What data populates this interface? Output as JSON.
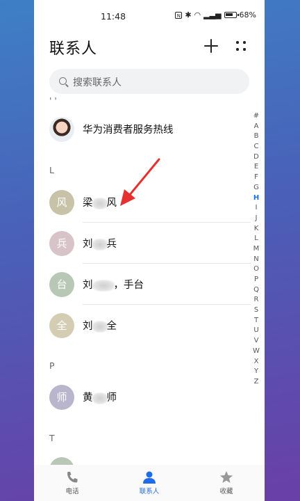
{
  "status_bar": {
    "time": "11:48",
    "battery": "68%"
  },
  "header": {
    "title": "联系人"
  },
  "search": {
    "placeholder": "搜索联系人"
  },
  "sections": {
    "top_marker": "' '",
    "L": "L",
    "P": "P",
    "T": "T"
  },
  "contacts": [
    {
      "name": "华为消费者服务热线",
      "avatar": ""
    },
    {
      "avatar": "风",
      "name_start": "梁",
      "name_end": "风"
    },
    {
      "avatar": "兵",
      "name_start": "刘",
      "name_end": "兵"
    },
    {
      "avatar": "台",
      "name_start": "刘",
      "name_end": "，手台"
    },
    {
      "avatar": "全",
      "name_start": "刘",
      "name_end": "全"
    },
    {
      "avatar": "师",
      "name_start": "黄",
      "name_end": "师"
    }
  ],
  "index_letters": [
    "#",
    "A",
    "B",
    "C",
    "D",
    "E",
    "F",
    "G",
    "H",
    "I",
    "J",
    "K",
    "L",
    "M",
    "N",
    "O",
    "P",
    "Q",
    "R",
    "S",
    "T",
    "U",
    "V",
    "W",
    "X",
    "Y",
    "Z"
  ],
  "active_index": "H",
  "bottom_nav": {
    "calls": "电话",
    "contacts": "联系人",
    "favorites": "收藏"
  },
  "colors": {
    "accent": "#1e6ce8",
    "avatar_feng": "#c8c2a8",
    "avatar_bing": "#d8c4c8",
    "avatar_tai": "#b7c8b5",
    "avatar_quan": "#d4cdb4",
    "avatar_shi": "#b9b5cc",
    "annotation_arrow": "#e53030"
  }
}
